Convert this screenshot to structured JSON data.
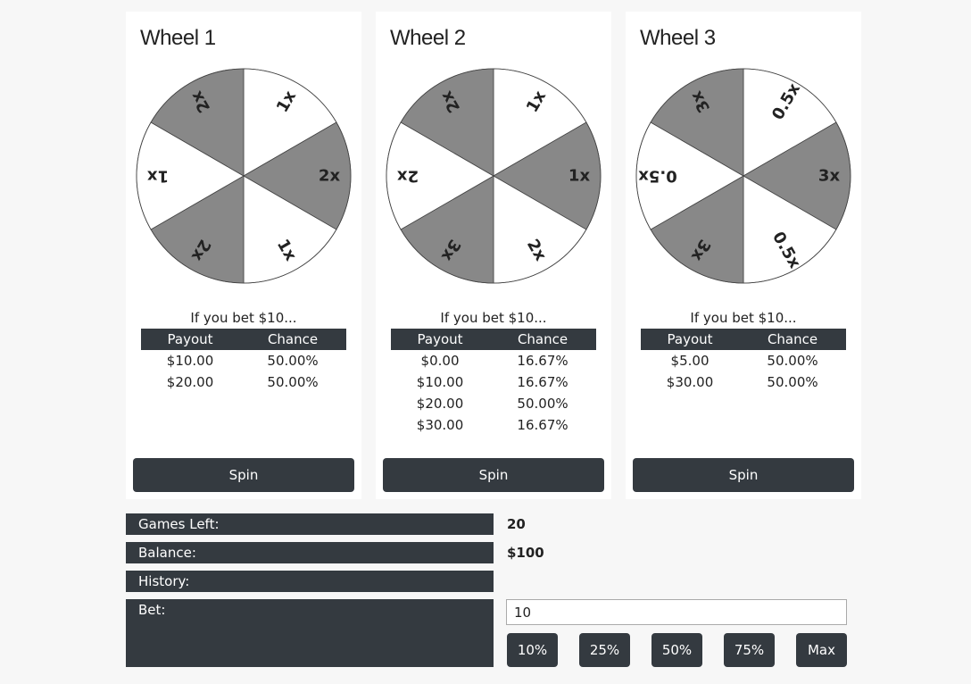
{
  "wheels": [
    {
      "title": "Wheel 1",
      "segments": [
        "1x",
        "2x",
        "1x",
        "2x",
        "1x",
        "2x"
      ],
      "bet_intro": "If you bet $10...",
      "table_headers": [
        "Payout",
        "Chance"
      ],
      "rows": [
        [
          "$10.00",
          "50.00%"
        ],
        [
          "$20.00",
          "50.00%"
        ]
      ],
      "spin_label": "Spin"
    },
    {
      "title": "Wheel 2",
      "segments": [
        "1x",
        "1x",
        "2x",
        "3x",
        "2x",
        "2x"
      ],
      "bet_intro": "If you bet $10...",
      "table_headers": [
        "Payout",
        "Chance"
      ],
      "rows": [
        [
          "$0.00",
          "16.67%"
        ],
        [
          "$10.00",
          "16.67%"
        ],
        [
          "$20.00",
          "50.00%"
        ],
        [
          "$30.00",
          "16.67%"
        ]
      ],
      "spin_label": "Spin"
    },
    {
      "title": "Wheel 3",
      "segments": [
        "0.5x",
        "3x",
        "0.5x",
        "3x",
        "0.5x",
        "3x"
      ],
      "bet_intro": "If you bet $10...",
      "table_headers": [
        "Payout",
        "Chance"
      ],
      "rows": [
        [
          "$5.00",
          "50.00%"
        ],
        [
          "$30.00",
          "50.00%"
        ]
      ],
      "spin_label": "Spin"
    }
  ],
  "colors": {
    "light_segment": "#ffffff",
    "dark_segment": "#888888",
    "accent": "#343a40"
  },
  "stats": {
    "games_left_label": "Games Left:",
    "games_left_value": "20",
    "balance_label": "Balance:",
    "balance_value": "$100",
    "history_label": "History:",
    "bet_label": "Bet:"
  },
  "bet_input_value": "10",
  "bet_buttons": [
    "10%",
    "25%",
    "50%",
    "75%",
    "Max"
  ]
}
